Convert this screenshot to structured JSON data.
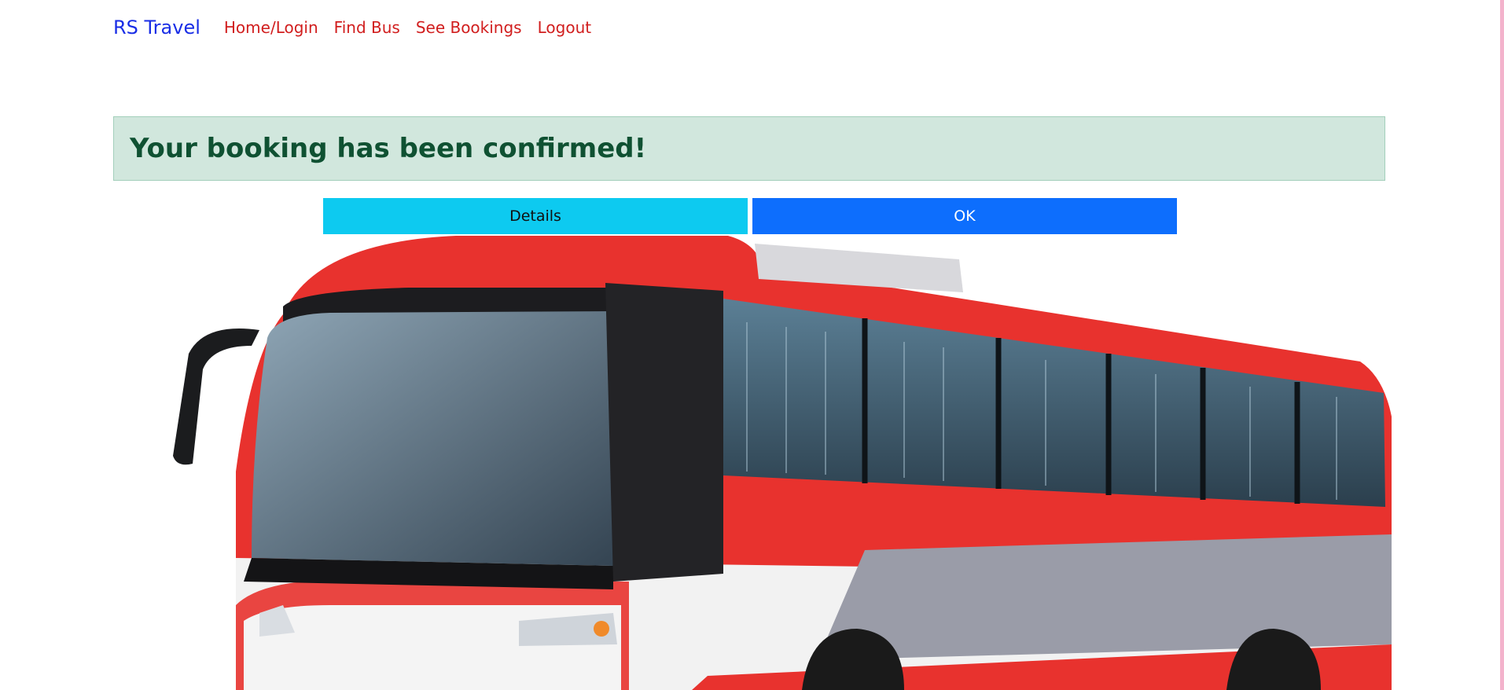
{
  "nav": {
    "brand": "RS Travel",
    "links": [
      "Home/Login",
      "Find Bus",
      "See Bookings",
      "Logout"
    ]
  },
  "alert": {
    "message": "Your booking has been confirmed!"
  },
  "actions": {
    "details_label": "Details",
    "ok_label": "OK"
  },
  "colors": {
    "brand": "#1a2ee6",
    "nav_link": "#d11e1e",
    "alert_bg": "#d1e7dd",
    "alert_text": "#0f5132",
    "details_button": "#0dcaf0",
    "ok_button": "#0d6efd",
    "bus_red": "#e8322e"
  }
}
